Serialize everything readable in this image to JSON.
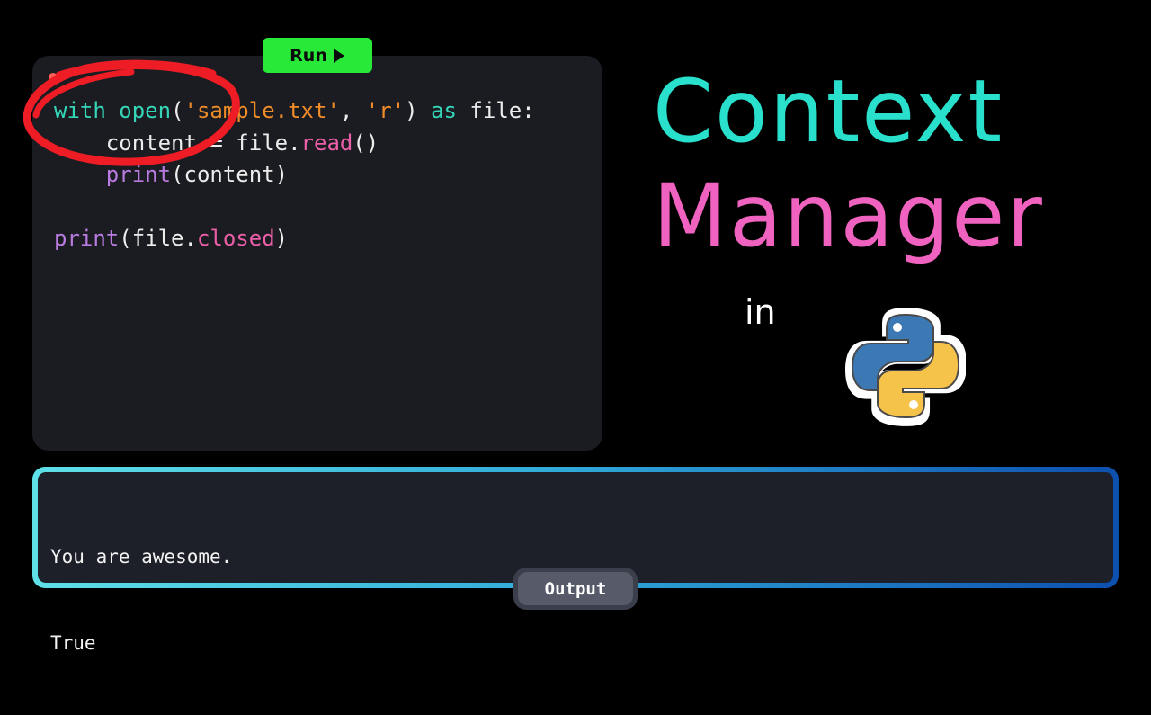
{
  "editor": {
    "run_label": "Run",
    "code_lines": [
      [
        {
          "t": "with",
          "c": "kw"
        },
        {
          "t": " ",
          "c": "plain"
        },
        {
          "t": "open",
          "c": "fn"
        },
        {
          "t": "(",
          "c": "punc"
        },
        {
          "t": "'sample.txt'",
          "c": "str"
        },
        {
          "t": ", ",
          "c": "punc"
        },
        {
          "t": "'r'",
          "c": "str"
        },
        {
          "t": ") ",
          "c": "punc"
        },
        {
          "t": "as",
          "c": "kw"
        },
        {
          "t": " file:",
          "c": "plain"
        }
      ],
      [
        {
          "t": "    content = file.",
          "c": "plain"
        },
        {
          "t": "read",
          "c": "attr"
        },
        {
          "t": "()",
          "c": "punc"
        }
      ],
      [
        {
          "t": "    ",
          "c": "plain"
        },
        {
          "t": "print",
          "c": "builtin"
        },
        {
          "t": "(content)",
          "c": "punc"
        }
      ],
      [],
      [
        {
          "t": "print",
          "c": "builtin"
        },
        {
          "t": "(file.",
          "c": "punc"
        },
        {
          "t": "closed",
          "c": "attr"
        },
        {
          "t": ")",
          "c": "punc"
        }
      ]
    ]
  },
  "title": {
    "line1": "Context",
    "line2": "Manager",
    "connector": "in",
    "logo_icon": "python-logo-icon"
  },
  "output": {
    "lines": [
      "You are awesome.",
      "True"
    ],
    "tab_label": "Output"
  },
  "colors": {
    "background": "#000000",
    "editor_bg": "#1b1c21",
    "run_button": "#28e838",
    "keyword": "#35d6b8",
    "string": "#f28c28",
    "builtin": "#b97be0",
    "attribute": "#ec5fa8",
    "title_context": "#28e0cc",
    "title_manager": "#f062bf",
    "annotation_circle": "#ee1c25"
  }
}
